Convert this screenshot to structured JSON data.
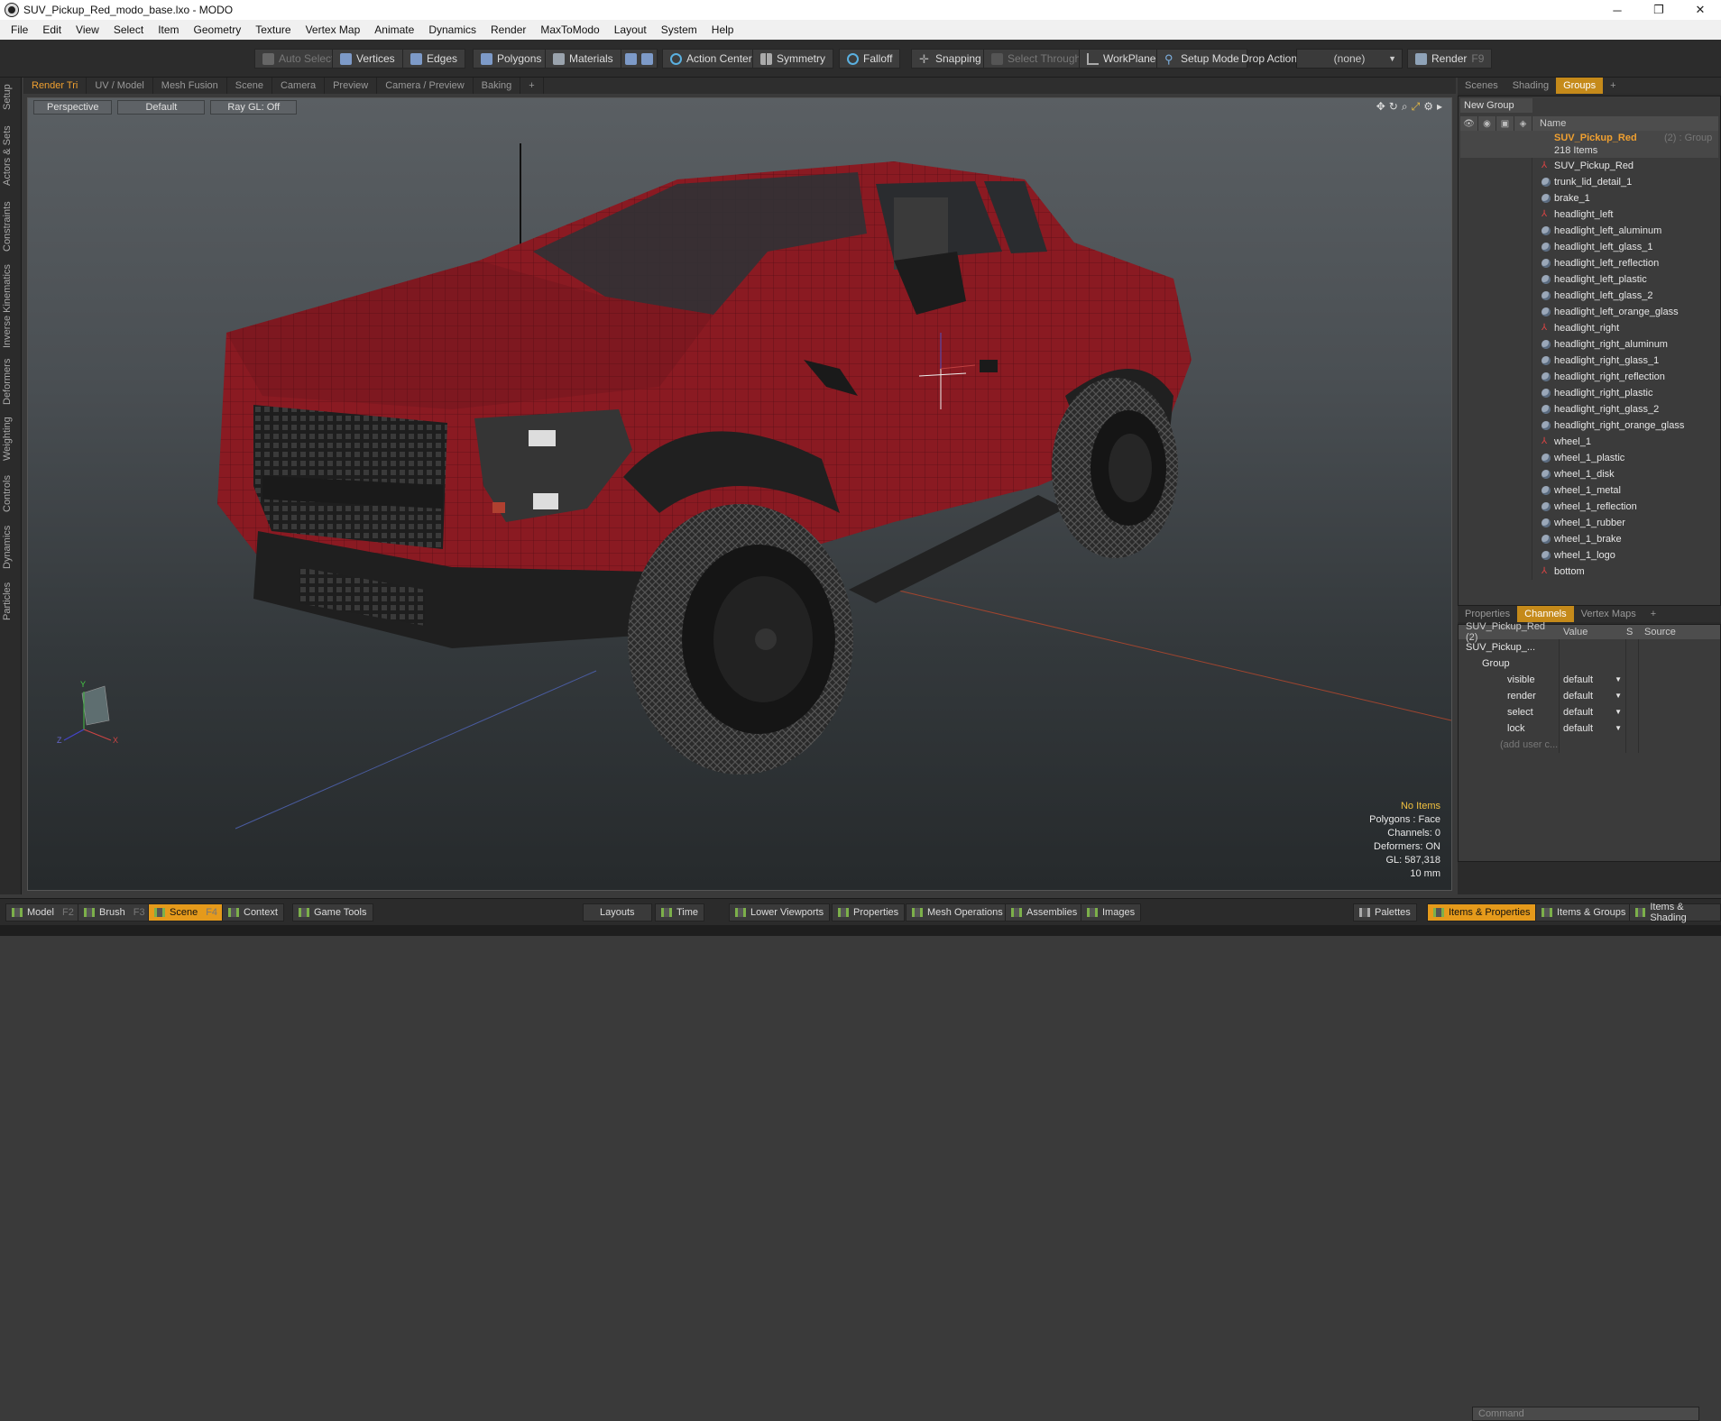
{
  "window": {
    "title": "SUV_Pickup_Red_modo_base.lxo - MODO",
    "minimize": "─",
    "restore": "❐",
    "close": "✕"
  },
  "menu": [
    "File",
    "Edit",
    "View",
    "Select",
    "Item",
    "Geometry",
    "Texture",
    "Vertex Map",
    "Animate",
    "Dynamics",
    "Render",
    "MaxToModo",
    "Layout",
    "System",
    "Help"
  ],
  "toolbar": {
    "auto_select": "Auto Select",
    "vertices": "Vertices",
    "edges": "Edges",
    "polygons": "Polygons",
    "materials": "Materials",
    "action_center": "Action Center",
    "symmetry": "Symmetry",
    "falloff": "Falloff",
    "snapping": "Snapping",
    "select_through": "Select Through",
    "workplane": "WorkPlane",
    "setup_mode": "Setup Mode",
    "drop_action": "Drop Action",
    "drop_value": "(none)",
    "render": "Render",
    "render_key": "F9"
  },
  "left_tabs": [
    "Setup",
    "Actors & Sets",
    "Constraints",
    "Inverse Kinematics",
    "Deformers",
    "Weighting",
    "Controls",
    "Dynamics",
    "Particles"
  ],
  "viewport_tabs": [
    "Render Tri",
    "UV / Model",
    "Mesh Fusion",
    "Scene",
    "Camera",
    "Preview",
    "Camera / Preview",
    "Baking",
    "+"
  ],
  "viewport": {
    "view": "Perspective",
    "shading": "Default",
    "raygl": "Ray GL: Off",
    "info": {
      "items": "No Items",
      "polygons": "Polygons : Face",
      "channels": "Channels: 0",
      "deformers": "Deformers: ON",
      "gl": "GL: 587,318",
      "unit": "10 mm"
    }
  },
  "right_tabs_top": [
    "Scenes",
    "Shading",
    "Groups",
    "+"
  ],
  "groups": {
    "new_group": "New Group",
    "name_col": "Name",
    "root_name": "SUV_Pickup_Red",
    "root_suffix": "(2) : Group",
    "root_count": "218 Items",
    "items": [
      {
        "name": "SUV_Pickup_Red",
        "type": "locator"
      },
      {
        "name": "trunk_lid_detail_1",
        "type": "mesh"
      },
      {
        "name": "brake_1",
        "type": "mesh"
      },
      {
        "name": "headlight_left",
        "type": "locator"
      },
      {
        "name": "headlight_left_aluminum",
        "type": "mesh"
      },
      {
        "name": "headlight_left_glass_1",
        "type": "mesh"
      },
      {
        "name": "headlight_left_reflection",
        "type": "mesh"
      },
      {
        "name": "headlight_left_plastic",
        "type": "mesh"
      },
      {
        "name": "headlight_left_glass_2",
        "type": "mesh"
      },
      {
        "name": "headlight_left_orange_glass",
        "type": "mesh"
      },
      {
        "name": "headlight_right",
        "type": "locator"
      },
      {
        "name": "headlight_right_aluminum",
        "type": "mesh"
      },
      {
        "name": "headlight_right_glass_1",
        "type": "mesh"
      },
      {
        "name": "headlight_right_reflection",
        "type": "mesh"
      },
      {
        "name": "headlight_right_plastic",
        "type": "mesh"
      },
      {
        "name": "headlight_right_glass_2",
        "type": "mesh"
      },
      {
        "name": "headlight_right_orange_glass",
        "type": "mesh"
      },
      {
        "name": "wheel_1",
        "type": "locator"
      },
      {
        "name": "wheel_1_plastic",
        "type": "mesh"
      },
      {
        "name": "wheel_1_disk",
        "type": "mesh"
      },
      {
        "name": "wheel_1_metal",
        "type": "mesh"
      },
      {
        "name": "wheel_1_reflection",
        "type": "mesh"
      },
      {
        "name": "wheel_1_rubber",
        "type": "mesh"
      },
      {
        "name": "wheel_1_brake",
        "type": "mesh"
      },
      {
        "name": "wheel_1_logo",
        "type": "mesh"
      },
      {
        "name": "bottom",
        "type": "locator"
      }
    ]
  },
  "right_tabs_bottom": [
    "Properties",
    "Channels",
    "Vertex Maps",
    "+"
  ],
  "channels": {
    "header": {
      "name": "SUV_Pickup_Red (2)",
      "value": "Value",
      "s": "S",
      "source": "Source"
    },
    "root": "SUV_Pickup_...",
    "group": "Group",
    "rows": [
      {
        "name": "visible",
        "value": "default"
      },
      {
        "name": "render",
        "value": "default"
      },
      {
        "name": "select",
        "value": "default"
      },
      {
        "name": "lock",
        "value": "default"
      }
    ],
    "add_user": "(add user c...",
    "command_placeholder": "Command"
  },
  "statusbar": {
    "model": "Model",
    "model_key": "F2",
    "brush": "Brush",
    "brush_key": "F3",
    "scene": "Scene",
    "scene_key": "F4",
    "context": "Context",
    "game_tools": "Game Tools",
    "layouts": "Layouts",
    "time": "Time",
    "lower_viewports": "Lower Viewports",
    "properties": "Properties",
    "mesh_operations": "Mesh Operations",
    "assemblies": "Assemblies",
    "images": "Images",
    "palettes": "Palettes",
    "items_properties": "Items & Properties",
    "items_groups": "Items & Groups",
    "items_shading": "Items & Shading"
  },
  "colors": {
    "accent": "#e59a1b",
    "body": "#8a1a22",
    "viewport_top": "#5a5f63"
  }
}
